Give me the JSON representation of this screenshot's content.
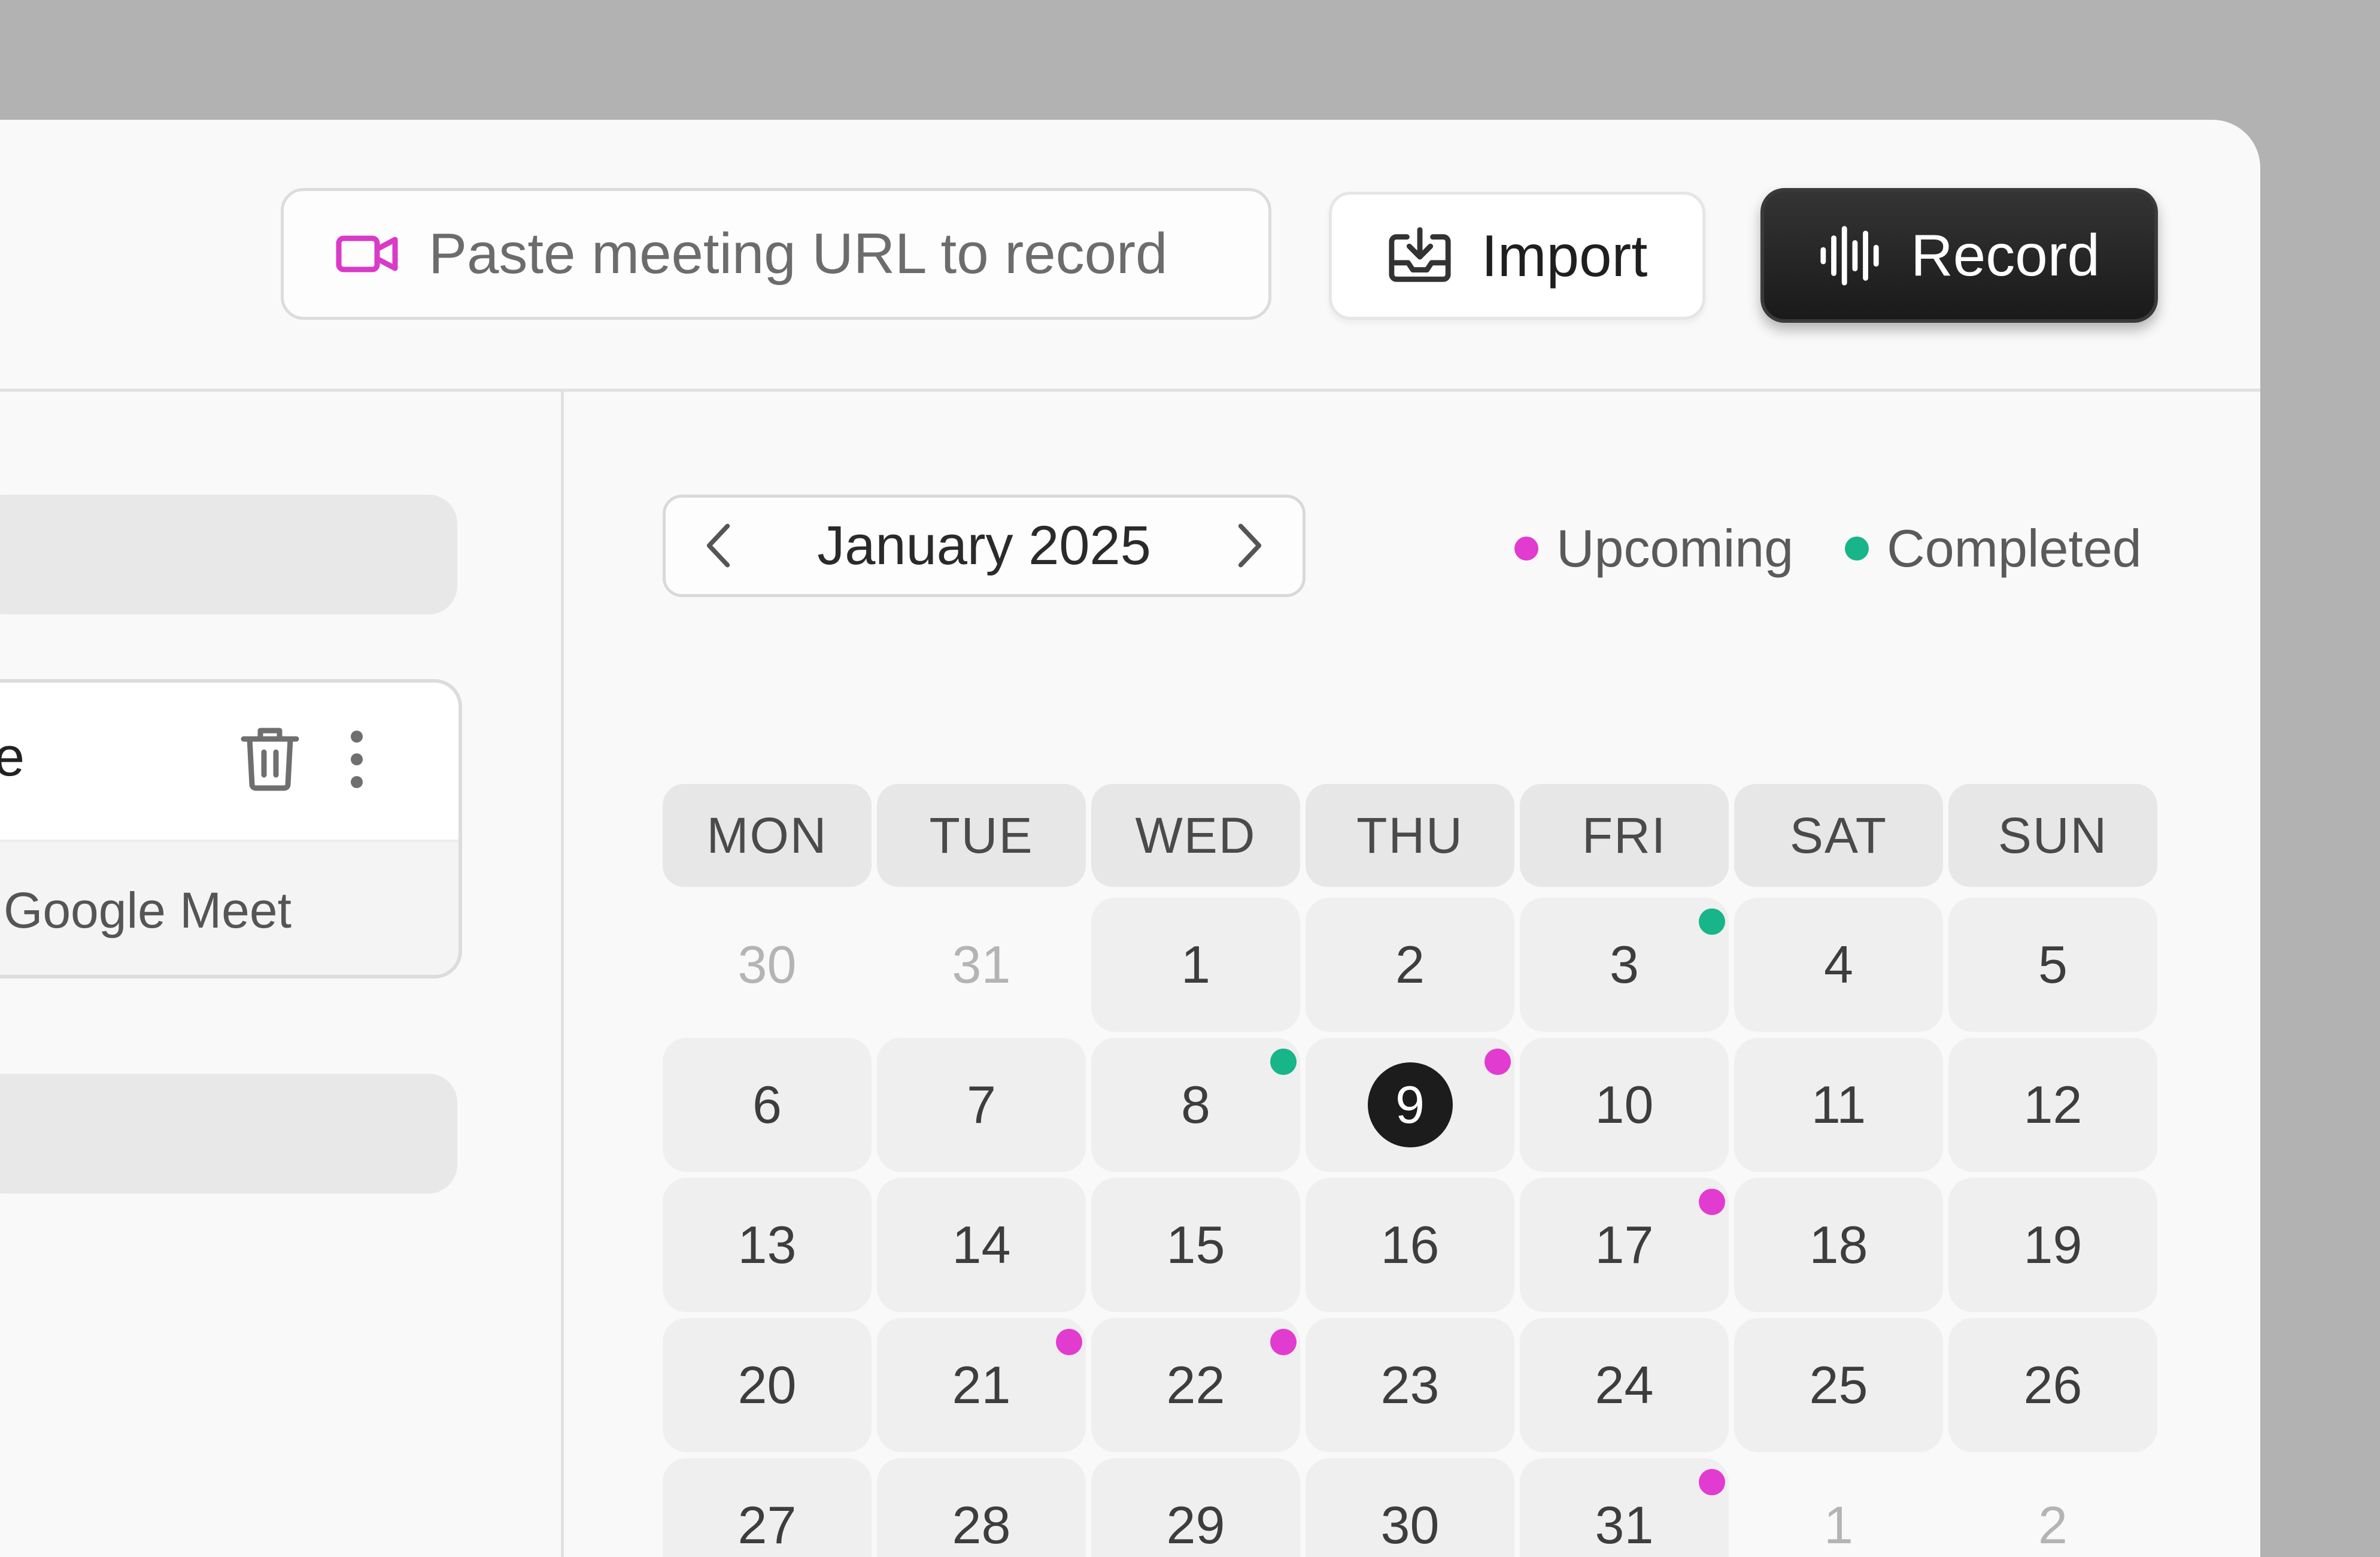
{
  "colors": {
    "upcoming": "#e23bcf",
    "completed": "#17b589",
    "accent_icon": "#d93ac8"
  },
  "toolbar": {
    "url_placeholder": "Paste meeting URL to record",
    "url_icon": "video-camera-icon",
    "import_label": "Import",
    "import_icon": "import-tray-icon",
    "record_label": "Record",
    "record_icon": "waveform-icon"
  },
  "sidebar": {
    "card": {
      "title": "e",
      "platform": "Google Meet"
    }
  },
  "calendar": {
    "month_label": "January 2025",
    "legend": [
      {
        "label": "Upcoming",
        "status": "upcoming"
      },
      {
        "label": "Completed",
        "status": "completed"
      }
    ],
    "weekdays": [
      "MON",
      "TUE",
      "WED",
      "THU",
      "FRI",
      "SAT",
      "SUN"
    ],
    "days": [
      {
        "n": "30",
        "muted": true
      },
      {
        "n": "31",
        "muted": true
      },
      {
        "n": "1"
      },
      {
        "n": "2"
      },
      {
        "n": "3",
        "event": "completed"
      },
      {
        "n": "4"
      },
      {
        "n": "5"
      },
      {
        "n": "6"
      },
      {
        "n": "7"
      },
      {
        "n": "8",
        "event": "completed"
      },
      {
        "n": "9",
        "today": true,
        "event": "upcoming"
      },
      {
        "n": "10"
      },
      {
        "n": "11"
      },
      {
        "n": "12"
      },
      {
        "n": "13"
      },
      {
        "n": "14"
      },
      {
        "n": "15"
      },
      {
        "n": "16"
      },
      {
        "n": "17",
        "event": "upcoming"
      },
      {
        "n": "18"
      },
      {
        "n": "19"
      },
      {
        "n": "20"
      },
      {
        "n": "21",
        "event": "upcoming"
      },
      {
        "n": "22",
        "event": "upcoming"
      },
      {
        "n": "23"
      },
      {
        "n": "24"
      },
      {
        "n": "25"
      },
      {
        "n": "26"
      },
      {
        "n": "27"
      },
      {
        "n": "28"
      },
      {
        "n": "29"
      },
      {
        "n": "30"
      },
      {
        "n": "31",
        "event": "upcoming"
      },
      {
        "n": "1",
        "muted": true
      },
      {
        "n": "2",
        "muted": true
      }
    ]
  }
}
